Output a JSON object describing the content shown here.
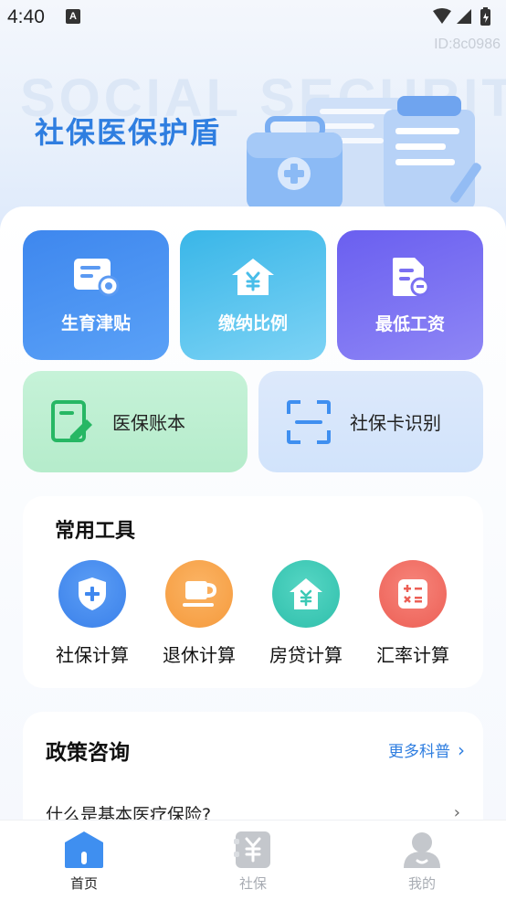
{
  "status_bar": {
    "time": "4:40",
    "notification_letter": "A"
  },
  "app_id": "ID:8c0986",
  "header": {
    "background_word": "SOCIAL SECURITY",
    "title": "社保医保护盾"
  },
  "quick_tiles": [
    {
      "label": "生育津贴",
      "icon": "subsidy-card-gear-icon"
    },
    {
      "label": "缴纳比例",
      "icon": "house-yen-icon"
    },
    {
      "label": "最低工资",
      "icon": "salary-document-icon"
    }
  ],
  "wide_tiles": [
    {
      "label": "医保账本",
      "icon": "ledger-pencil-icon"
    },
    {
      "label": "社保卡识别",
      "icon": "scan-frame-icon"
    }
  ],
  "tools": {
    "title": "常用工具",
    "items": [
      {
        "label": "社保计算",
        "icon": "shield-plus-icon",
        "color": "#3f88ef"
      },
      {
        "label": "退休计算",
        "icon": "coffee-cup-icon",
        "color": "#f7a046"
      },
      {
        "label": "房贷计算",
        "icon": "house-yen-icon",
        "color": "#3cc9b5"
      },
      {
        "label": "汇率计算",
        "icon": "calculator-icon",
        "color": "#f06e63"
      }
    ]
  },
  "policy": {
    "title": "政策咨询",
    "more_label": "更多科普",
    "items": [
      {
        "question": "什么是基本医疗保险?"
      }
    ]
  },
  "bottom_nav": {
    "items": [
      {
        "label": "首页",
        "active": true
      },
      {
        "label": "社保",
        "active": false
      },
      {
        "label": "我的",
        "active": false
      }
    ],
    "active_color": "#222222",
    "inactive_color": "#a8acb3",
    "accent": "#3f8ff0"
  }
}
